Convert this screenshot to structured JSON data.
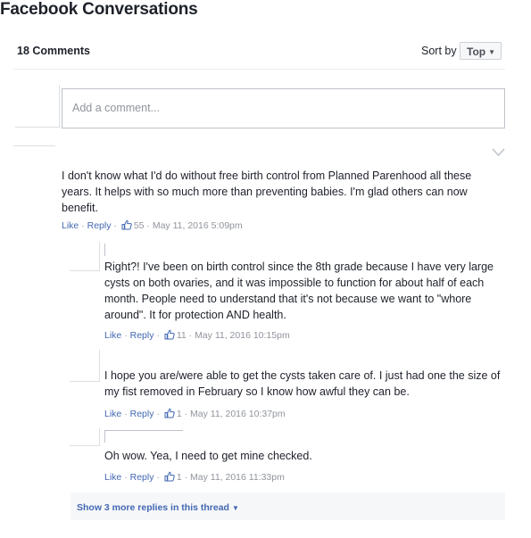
{
  "page_title": "Facebook Conversations",
  "header": {
    "comment_count": "18 Comments",
    "sort_label": "Sort by",
    "sort_value": "Top"
  },
  "composer": {
    "placeholder": "Add a comment..."
  },
  "meta": {
    "like": "Like",
    "reply": "Reply",
    "sep": "·"
  },
  "comments": [
    {
      "text": "I don't know what I'd do without free birth control from Planned Parenhood all these years. It helps with so much more than preventing babies. I'm glad others can now benefit.",
      "likes": "55",
      "timestamp": "May 11, 2016 5:09pm"
    }
  ],
  "replies": [
    {
      "text": "Right?! I've been on birth control since the 8th grade because I have very large cysts on both ovaries, and it was impossible to function for about half of each month. People need to understand that it's not because we want to \"whore around\". It for protection AND health.",
      "likes": "11",
      "timestamp": "May 11, 2016 10:15pm"
    },
    {
      "text": "I hope you are/were able to get the cysts taken care of. I just had one the size of my fist removed in February so I know how awful they can be.",
      "likes": "1",
      "timestamp": "May 11, 2016 10:37pm"
    },
    {
      "text": "Oh wow. Yea, I need to get mine checked.",
      "likes": "1",
      "timestamp": "May 11, 2016 11:33pm"
    }
  ],
  "show_more": "Show 3 more replies in this thread",
  "colors": {
    "link": "#4267b2",
    "muted": "#90949c",
    "text": "#1d2129",
    "thread_bg": "#f6f7f9"
  },
  "icons": [
    "thumbs-up-icon",
    "chevron-down-icon",
    "caret-down-icon"
  ]
}
